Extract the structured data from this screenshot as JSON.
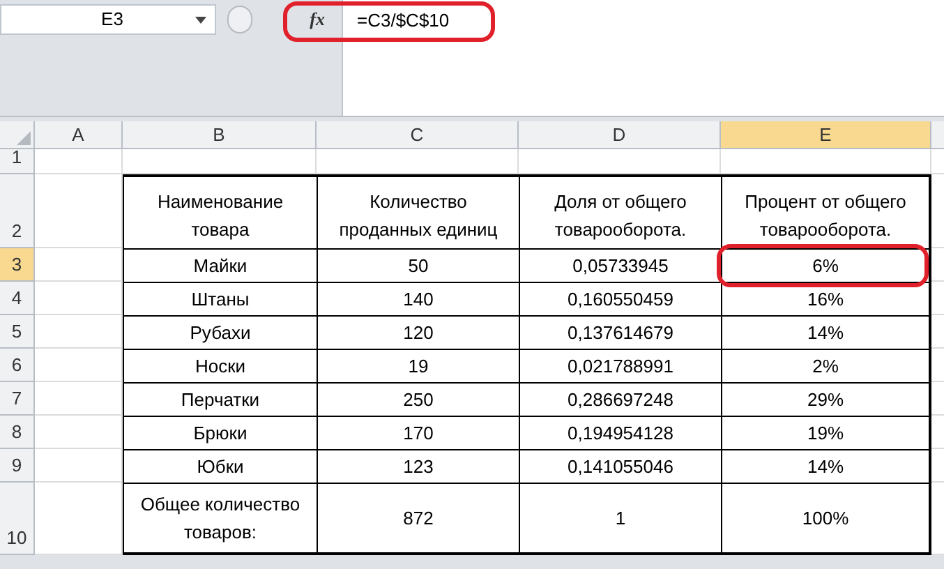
{
  "name_box": "E3",
  "formula_button": "fx",
  "formula": "=C3/$C$10",
  "columns": [
    {
      "label": "A",
      "selected": false
    },
    {
      "label": "B",
      "selected": false
    },
    {
      "label": "C",
      "selected": false
    },
    {
      "label": "D",
      "selected": false
    },
    {
      "label": "E",
      "selected": true
    }
  ],
  "rows": [
    {
      "number": "1",
      "selected": false
    },
    {
      "number": "2",
      "selected": false,
      "cells": [
        "Наименование товара",
        "Количество проданных единиц",
        "Доля от общего товарооборота.",
        "Процент от общего товарооборота."
      ]
    },
    {
      "number": "3",
      "selected": true,
      "cells": [
        "Майки",
        "50",
        "0,05733945",
        "6%"
      ]
    },
    {
      "number": "4",
      "selected": false,
      "cells": [
        "Штаны",
        "140",
        "0,160550459",
        "16%"
      ]
    },
    {
      "number": "5",
      "selected": false,
      "cells": [
        "Рубахи",
        "120",
        "0,137614679",
        "14%"
      ]
    },
    {
      "number": "6",
      "selected": false,
      "cells": [
        "Носки",
        "19",
        "0,021788991",
        "2%"
      ]
    },
    {
      "number": "7",
      "selected": false,
      "cells": [
        "Перчатки",
        "250",
        "0,286697248",
        "29%"
      ]
    },
    {
      "number": "8",
      "selected": false,
      "cells": [
        "Брюки",
        "170",
        "0,194954128",
        "19%"
      ]
    },
    {
      "number": "9",
      "selected": false,
      "cells": [
        "Юбки",
        "123",
        "0,141055046",
        "14%"
      ]
    },
    {
      "number": "10",
      "selected": false,
      "cells": [
        "Общее количество товаров:",
        "872",
        "1",
        "100%"
      ]
    }
  ]
}
